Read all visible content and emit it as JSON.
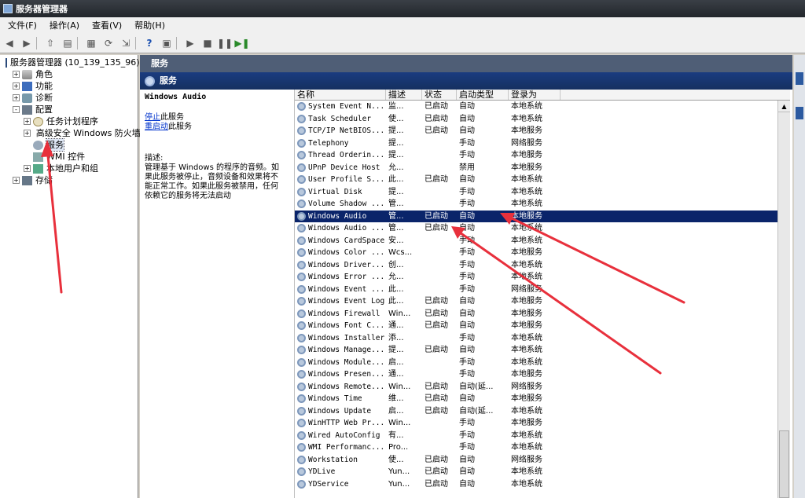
{
  "window": {
    "title": "服务器管理器"
  },
  "menu": [
    "文件(F)",
    "操作(A)",
    "查看(V)",
    "帮助(H)"
  ],
  "tree": [
    {
      "label": "服务器管理器 (10_139_135_96)",
      "icon": "server-icon",
      "level": 0,
      "exp": ""
    },
    {
      "label": "角色",
      "icon": "roles-icon",
      "level": 1,
      "exp": "+"
    },
    {
      "label": "功能",
      "icon": "features-icon",
      "level": 1,
      "exp": "+"
    },
    {
      "label": "诊断",
      "icon": "diagnostics-icon",
      "level": 1,
      "exp": "+"
    },
    {
      "label": "配置",
      "icon": "configuration-icon",
      "level": 1,
      "exp": "-"
    },
    {
      "label": "任务计划程序",
      "icon": "task-scheduler-icon",
      "level": 2,
      "exp": "+"
    },
    {
      "label": "高级安全 Windows 防火墙",
      "icon": "firewall-icon",
      "level": 2,
      "exp": "+"
    },
    {
      "label": "服务",
      "icon": "services-icon",
      "level": 2,
      "exp": "",
      "selected": true
    },
    {
      "label": "WMI 控件",
      "icon": "wmi-icon",
      "level": 2,
      "exp": ""
    },
    {
      "label": "本地用户和组",
      "icon": "users-icon",
      "level": 2,
      "exp": "+"
    },
    {
      "label": "存储",
      "icon": "storage-icon",
      "level": 1,
      "exp": "+"
    }
  ],
  "header": {
    "top": "服务",
    "sub": "服务"
  },
  "desc": {
    "title": "Windows Audio",
    "stop": "停止",
    "stop_suffix": "此服务",
    "restart": "重启动",
    "restart_suffix": "此服务",
    "label": "描述:",
    "text": "管理基于 Windows 的程序的音频。如果此服务被停止，音频设备和效果将不能正常工作。如果此服务被禁用，任何依赖它的服务将无法启动"
  },
  "columns": [
    "名称",
    "描述",
    "状态",
    "启动类型",
    "登录为"
  ],
  "rows": [
    [
      "System Event N...",
      "监...",
      "已启动",
      "自动",
      "本地系统"
    ],
    [
      "Task Scheduler",
      "使...",
      "已启动",
      "自动",
      "本地系统"
    ],
    [
      "TCP/IP NetBIOS...",
      "提...",
      "已启动",
      "自动",
      "本地服务"
    ],
    [
      "Telephony",
      "提...",
      "",
      "手动",
      "网络服务"
    ],
    [
      "Thread Orderin...",
      "提...",
      "",
      "手动",
      "本地服务"
    ],
    [
      "UPnP Device Host",
      "允...",
      "",
      "禁用",
      "本地服务"
    ],
    [
      "User Profile S...",
      "此...",
      "已启动",
      "自动",
      "本地系统"
    ],
    [
      "Virtual Disk",
      "提...",
      "",
      "手动",
      "本地系统"
    ],
    [
      "Volume Shadow ...",
      "管...",
      "",
      "手动",
      "本地系统"
    ],
    [
      "Windows Audio",
      "管...",
      "已启动",
      "自动",
      "本地服务"
    ],
    [
      "Windows Audio ...",
      "管...",
      "已启动",
      "自动",
      "本地系统"
    ],
    [
      "Windows CardSpace",
      "安...",
      "",
      "手动",
      "本地系统"
    ],
    [
      "Windows Color ...",
      "Wcs...",
      "",
      "手动",
      "本地服务"
    ],
    [
      "Windows Driver...",
      "创...",
      "",
      "手动",
      "本地系统"
    ],
    [
      "Windows Error ...",
      "允...",
      "",
      "手动",
      "本地系统"
    ],
    [
      "Windows Event ...",
      "此...",
      "",
      "手动",
      "网络服务"
    ],
    [
      "Windows Event Log",
      "此...",
      "已启动",
      "自动",
      "本地服务"
    ],
    [
      "Windows Firewall",
      "Win...",
      "已启动",
      "自动",
      "本地服务"
    ],
    [
      "Windows Font C...",
      "通...",
      "已启动",
      "自动",
      "本地服务"
    ],
    [
      "Windows Installer",
      "添...",
      "",
      "手动",
      "本地系统"
    ],
    [
      "Windows Manage...",
      "提...",
      "已启动",
      "自动",
      "本地系统"
    ],
    [
      "Windows Module...",
      "启...",
      "",
      "手动",
      "本地系统"
    ],
    [
      "Windows Presen...",
      "通...",
      "",
      "手动",
      "本地服务"
    ],
    [
      "Windows Remote...",
      "Win...",
      "已启动",
      "自动(延...",
      "网络服务"
    ],
    [
      "Windows Time",
      "维...",
      "已启动",
      "自动",
      "本地服务"
    ],
    [
      "Windows Update",
      "启...",
      "已启动",
      "自动(延...",
      "本地系统"
    ],
    [
      "WinHTTP Web Pr...",
      "Win...",
      "",
      "手动",
      "本地服务"
    ],
    [
      "Wired AutoConfig",
      "有...",
      "",
      "手动",
      "本地系统"
    ],
    [
      "WMI Performanc...",
      "Pro...",
      "",
      "手动",
      "本地系统"
    ],
    [
      "Workstation",
      "使...",
      "已启动",
      "自动",
      "网络服务"
    ],
    [
      "YDLive",
      "Yun...",
      "已启动",
      "自动",
      "本地系统"
    ],
    [
      "YDService",
      "Yun...",
      "已启动",
      "自动",
      "本地系统"
    ]
  ],
  "selected_row": 9,
  "colors": {
    "selection": "#0a246a",
    "annotation_arrow": "#e8303c"
  }
}
